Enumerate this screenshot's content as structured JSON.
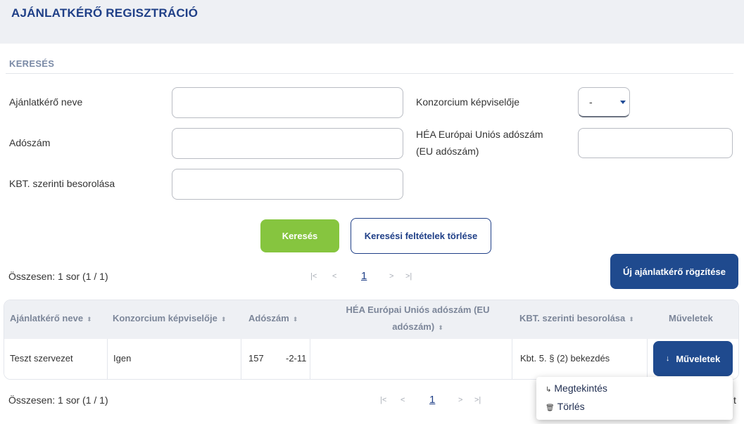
{
  "page": {
    "title": "AJÁNLATKÉRŐ REGISZTRÁCIÓ"
  },
  "search": {
    "section_title": "KERESÉS",
    "fields": {
      "name": {
        "label": "Ajánlatkérő neve",
        "value": ""
      },
      "consortium": {
        "label": "Konzorcium képviselője",
        "value": "-"
      },
      "tax": {
        "label": "Adószám",
        "value": ""
      },
      "eu_tax": {
        "label_line1": "HÉA Európai Uniós adószám",
        "label_line2": "(EU adószám)",
        "value": ""
      },
      "kbt": {
        "label": "KBT. szerinti besorolása",
        "value": ""
      }
    },
    "search_button": "Keresés",
    "clear_button": "Keresési feltételek törlése"
  },
  "new_button": "Új ajánlatkérő rögzítése",
  "pagination": {
    "summary": "Összesen: 1 sor (1 / 1)",
    "current_page": "1"
  },
  "table": {
    "headers": {
      "name": "Ajánlatkérő neve",
      "consortium": "Konzorcium képviselője",
      "tax": "Adószám",
      "eu_tax_line1": "HÉA Európai Uniós adószám (EU",
      "eu_tax_line2": "adószám)",
      "kbt": "KBT. szerinti besorolása",
      "actions": "Műveletek"
    },
    "row": {
      "name": "Teszt szervezet",
      "consortium": "Igen",
      "tax_part1": "157",
      "tax_part2": "-2-11",
      "eu_tax": "",
      "kbt": "Kbt. 5. § (2) bekezdés",
      "actions_button": "Műveletek"
    }
  },
  "actions_menu": {
    "view": "Megtekintés",
    "delete": "Törlés"
  },
  "trailing_text": "t",
  "icons": {
    "first_page": "first-page-icon",
    "prev_page": "prev-page-icon",
    "next_page": "next-page-icon",
    "last_page": "last-page-icon",
    "sort": "sort-icon",
    "arrow_down": "arrow-down-icon",
    "view": "view-arrow-icon",
    "trash": "trash-icon"
  },
  "colors": {
    "brand": "#1f3f87",
    "accent_green": "#86c53f",
    "button_navy": "#1f4a8e"
  }
}
